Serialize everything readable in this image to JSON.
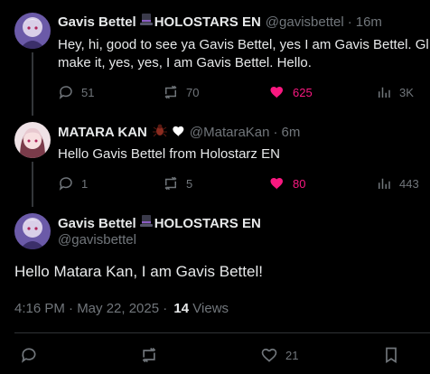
{
  "reply1": {
    "name": "Gavis Bettel",
    "org": "HOLOSTARS EN",
    "handle": "@gavisbettel",
    "sep": "·",
    "time": "16m",
    "text_line1": "Hey, hi, good to see ya Gavis Bettel, yes I am Gavis Bettel. Gl",
    "text_line2": "make it, yes, yes, I am Gavis Bettel. Hello.",
    "replies": "51",
    "reposts": "70",
    "likes": "625",
    "views": "3K"
  },
  "reply2": {
    "name": "MATARA KAN",
    "handle": "@MataraKan",
    "sep": "·",
    "time": "6m",
    "text": "Hello Gavis Bettel from Holostarz EN",
    "replies": "1",
    "reposts": "5",
    "likes": "80",
    "views": "443"
  },
  "main": {
    "name": "Gavis Bettel",
    "org": "HOLOSTARS EN",
    "handle": "@gavisbettel",
    "text": "Hello Matara Kan, I am Gavis Bettel!",
    "timestamp": "4:16 PM · May 22, 2025 ·",
    "views_count": "14",
    "views_label": "Views",
    "likes": "21"
  },
  "colors": {
    "background": "#000000",
    "text": "#e7e9ea",
    "muted": "#71767b",
    "like": "#f91880",
    "divider": "#2f3336"
  },
  "icons": [
    "reply-icon",
    "repost-icon",
    "heart-icon",
    "views-icon",
    "bookmark-icon",
    "top-hat-icon",
    "bug-icon",
    "white-heart-icon"
  ]
}
